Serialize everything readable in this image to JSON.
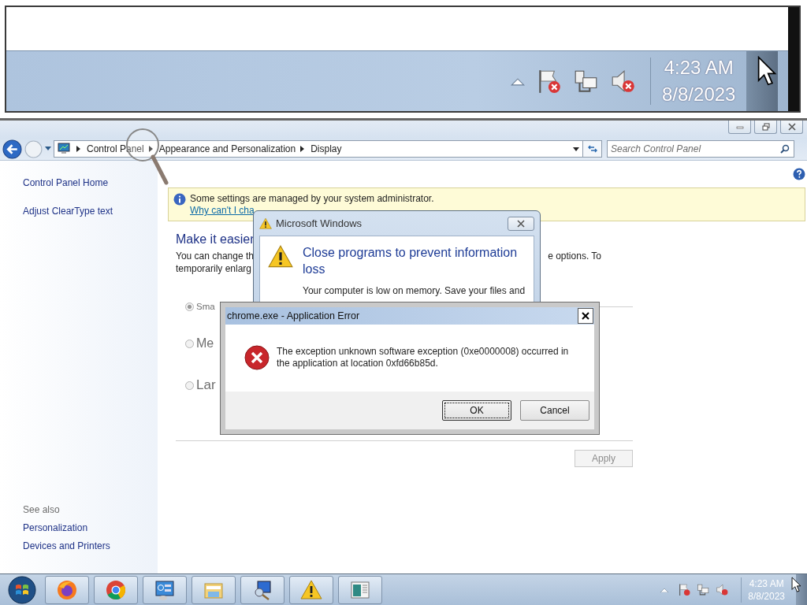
{
  "magnified_tray": {
    "time": "4:23 AM",
    "date": "8/8/2023"
  },
  "window": {
    "breadcrumbs": [
      "Control Panel",
      "Appearance and Personalization",
      "Display"
    ],
    "search": {
      "placeholder": "Search Control Panel"
    }
  },
  "sidebar": {
    "items": [
      "Control Panel Home",
      "Adjust ClearType text"
    ],
    "see_also_heading": "See also",
    "see_also": [
      "Personalization",
      "Devices and Printers"
    ]
  },
  "notice": {
    "text": "Some settings are managed by your system administrator.",
    "link": "Why can't I cha"
  },
  "content": {
    "heading": "Make it easier",
    "text_lines": [
      "You can change th",
      "temporarily enlarg"
    ],
    "text_right": "e options. To",
    "options": [
      {
        "label": "Sma",
        "selected": true
      },
      {
        "label": "Me",
        "selected": false
      },
      {
        "label": "Lar",
        "selected": false
      }
    ],
    "apply": {
      "label": "Apply",
      "disabled": true
    }
  },
  "memory_dialog": {
    "title": "Microsoft Windows",
    "heading": "Close programs to prevent information loss",
    "body": "Your computer is low on memory. Save your files and"
  },
  "error_dialog": {
    "title": "chrome.exe - Application Error",
    "message": "The exception unknown software exception (0xe0000008) occurred in the application at location 0xfd66b85d.",
    "buttons": [
      {
        "label": "OK",
        "default": true
      },
      {
        "label": "Cancel",
        "default": false
      }
    ]
  },
  "taskbar": {
    "time": "4:23 AM",
    "date": "8/8/2023"
  }
}
